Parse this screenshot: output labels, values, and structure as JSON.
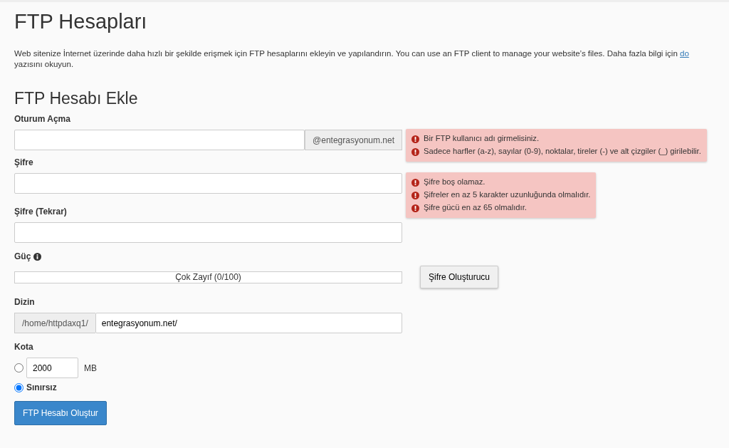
{
  "page_title": "FTP Hesapları",
  "description": {
    "text": "Web sitenize İnternet üzerinde daha hızlı bir şekilde erişmek için FTP hesaplarını ekleyin ve yapılandırın. You can use an FTP client to manage your website’s files. Daha fazla bilgi için",
    "link": "do",
    "text_after": "yazısını okuyun."
  },
  "section_title": "FTP Hesabı Ekle",
  "login": {
    "label": "Oturum Açma",
    "suffix": "@entegrasyonum.net",
    "errors": [
      "Bir FTP kullanıcı adı girmelisiniz.",
      "Sadece harfler (a-z), sayılar (0-9), noktalar, tireler (-) ve alt çizgiler (_) girilebilir."
    ]
  },
  "password": {
    "label": "Şifre",
    "errors": [
      "Şifre boş olamaz.",
      "Şifreler en az 5 karakter uzunluğunda olmalıdır.",
      "Şifre gücü en az 65 olmalıdır."
    ]
  },
  "password_repeat": {
    "label": "Şifre (Tekrar)"
  },
  "strength": {
    "label": "Güç",
    "reading": "Çok Zayıf (0/100)",
    "generator_button": "Şifre Oluşturucu"
  },
  "directory": {
    "label": "Dizin",
    "prefix": "/home/httpdaxq1/",
    "value": "entegrasyonum.net/"
  },
  "quota": {
    "label": "Kota",
    "options": [
      {
        "kind": "limited",
        "value": "2000",
        "unit": "MB",
        "selected": false
      },
      {
        "kind": "unlimited",
        "label": "Sınırsız",
        "selected": true
      }
    ]
  },
  "submit_button": "FTP Hesabı Oluştur"
}
